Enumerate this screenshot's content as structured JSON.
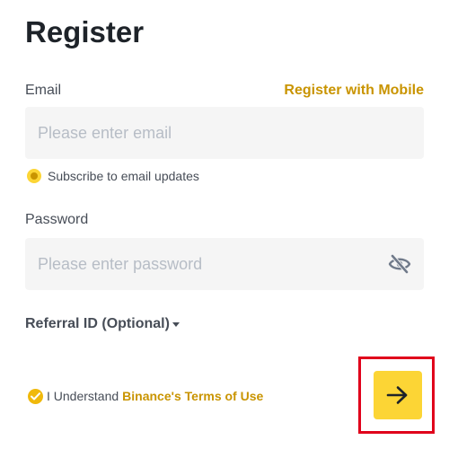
{
  "header": {
    "title": "Register"
  },
  "email": {
    "label": "Email",
    "placeholder": "Please enter email",
    "value": "",
    "alt_link": "Register with Mobile"
  },
  "subscribe": {
    "label": "Subscribe to email updates",
    "checked": true
  },
  "password": {
    "label": "Password",
    "placeholder": "Please enter password",
    "value": "",
    "toggle_icon": "eye-hidden-icon"
  },
  "referral": {
    "label": "Referral ID (Optional)",
    "icon": "caret-down-icon"
  },
  "terms": {
    "prefix": "I Understand",
    "link": "Binance's Terms of Use",
    "checked": true
  },
  "next_button": {
    "icon": "arrow-right-icon"
  },
  "colors": {
    "accent": "#fcd535",
    "link": "#c99400",
    "input_bg": "#f5f5f5",
    "highlight": "#e0001b"
  }
}
